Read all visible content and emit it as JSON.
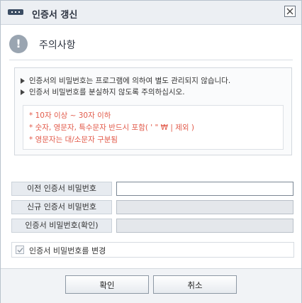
{
  "window": {
    "title": "인증서 갱신",
    "close_label": "×"
  },
  "notice": {
    "icon": "!",
    "title": "주의사항",
    "lines": [
      "인증서의 비밀번호는 프로그램에 의하여 별도 관리되지 않습니다.",
      "인증서 비밀번호를 분실하지 않도록 주의하십시오."
    ],
    "rules": [
      "* 10자 이상 ~ 30자 이하",
      "* 숫자, 영문자, 특수문자 반드시 포함( ' \" ₩ | 제외 )",
      "* 영문자는 대/소문자 구분됨"
    ]
  },
  "fields": {
    "old_password": {
      "label": "이전 인증서 비밀번호",
      "value": ""
    },
    "new_password": {
      "label": "신규 인증서 비밀번호",
      "value": ""
    },
    "confirm_password": {
      "label": "인증서 비밀번호(확인)",
      "value": ""
    }
  },
  "change_checkbox": {
    "label": "인증서 비밀번호를 변경",
    "checked": true
  },
  "buttons": {
    "ok": "확인",
    "cancel": "취소"
  },
  "colors": {
    "rule_text": "#e25b4b",
    "title_bar": "#eceff3",
    "accent": "#3b4d63"
  }
}
